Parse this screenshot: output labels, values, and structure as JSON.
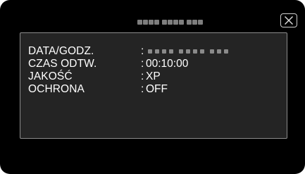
{
  "screen": {
    "title_icon": "date-placeholder-dashes",
    "close_icon": "close-x-icon"
  },
  "info": {
    "rows": [
      {
        "label": "DATA/GODZ.",
        "value": ""
      },
      {
        "label": "CZAS ODTW.",
        "value": "00:10:00"
      },
      {
        "label": "JAKOŚĆ",
        "value": "XP"
      },
      {
        "label": "OCHRONA",
        "value": "OFF"
      }
    ],
    "separator": ":"
  },
  "colors": {
    "background": "#000000",
    "panel": "#242424",
    "panel_border": "#8c8c8c",
    "text": "#ffffff",
    "placeholder": "#7e7e7e"
  }
}
